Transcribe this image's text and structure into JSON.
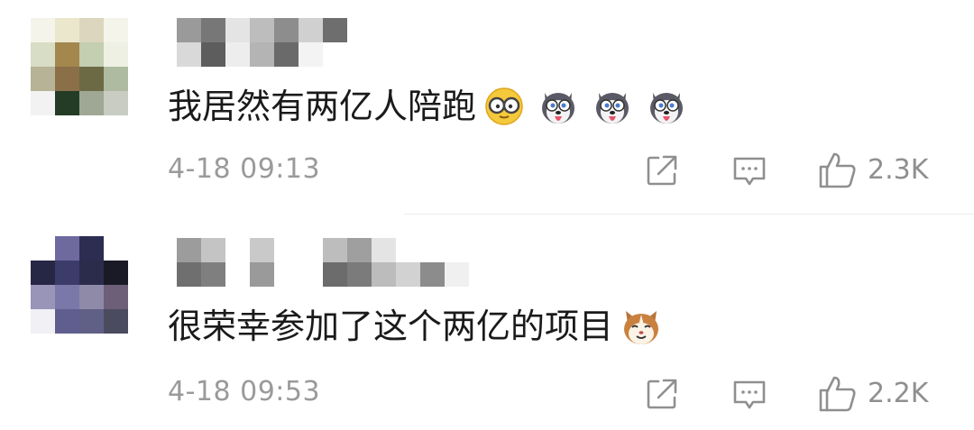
{
  "comments": [
    {
      "text": "我居然有两亿人陪跑",
      "emojis": [
        "nerd-glasses-emoji",
        "husky-emoji",
        "husky-emoji",
        "husky-emoji"
      ],
      "time": "4-18 09:13",
      "likes": "2.3K",
      "avatar_colors": [
        "#f4f4ea",
        "#eae7cc",
        "#dcd6be",
        "#f4f4ea",
        "#d8ddc5",
        "#a3874d",
        "#c4ceb1",
        "#eef0e4",
        "#b6b396",
        "#8b6f49",
        "#6b6a45",
        "#aebba1",
        "#f2f2f2",
        "#243c25",
        "#9fa895",
        "#c8ccc2"
      ],
      "username_colors": [
        "#9a9a9a",
        "#777777",
        "#e4e4e4",
        "#bdbdbd",
        "#8d8d8d",
        "#d0d0d0",
        "#6e6e6e",
        "#d9d9d9",
        "#5d5d5d",
        "#ededed",
        "#b4b4b4",
        "#6a6a6a",
        "#f3f3f3",
        "#ffffff"
      ]
    },
    {
      "text": "很荣幸参加了这个两亿的项目",
      "emojis": [
        "cat-emoji"
      ],
      "time": "4-18 09:53",
      "likes": "2.2K",
      "avatar_colors": [
        "#ffffff",
        "#6e6aa0",
        "#2d2d52",
        "#ffffff",
        "#262645",
        "#3c3c6a",
        "#2b2b4c",
        "#1a1a26",
        "#9895b8",
        "#7a78a8",
        "#8e8aa7",
        "#6c5f77",
        "#f0f0f5",
        "#5f5e8e",
        "#605f86",
        "#4a4b5f"
      ],
      "username_colors": [
        "#9c9c9c",
        "#c4c4c4",
        "#ffffff",
        "#c9c9c9",
        "#ffffff",
        "#ffffff",
        "#bdbdbd",
        "#9f9f9f",
        "#e4e4e4",
        "#ffffff",
        "#ffffff",
        "#ffffff",
        "#6f6f6f",
        "#7f7f7f",
        "#ffffff",
        "#9a9a9a",
        "#ffffff",
        "#ffffff",
        "#6c6c6c",
        "#7b7b7b",
        "#bcbcbc",
        "#d2d2d2",
        "#8c8c8c",
        "#f0f0f0"
      ]
    }
  ]
}
